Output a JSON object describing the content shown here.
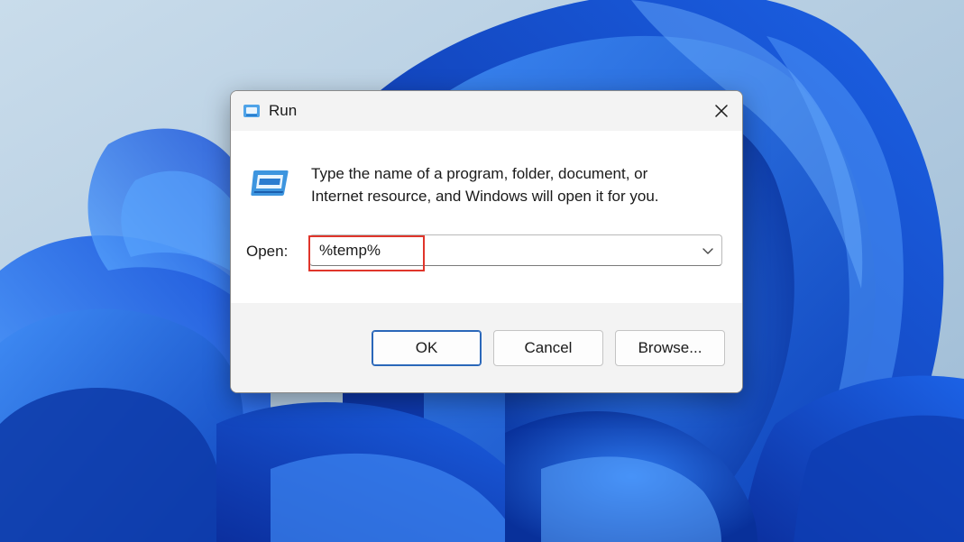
{
  "window": {
    "title": "Run",
    "title_icon": "run-icon",
    "close_icon": "close-icon"
  },
  "content": {
    "app_icon": "run-app-icon",
    "description_line1": "Type the name of a program, folder, document, or",
    "description_line2": "Internet resource, and Windows will open it for you.",
    "open_label": "Open:",
    "open_value": "%temp%",
    "dropdown_icon": "chevron-down-icon"
  },
  "buttons": {
    "ok_label": "OK",
    "cancel_label": "Cancel",
    "browse_label": "Browse..."
  },
  "colors": {
    "highlight": "#e0352b",
    "accent": "#2a67b9",
    "wallpaper_blue": "#1d5fe0"
  }
}
